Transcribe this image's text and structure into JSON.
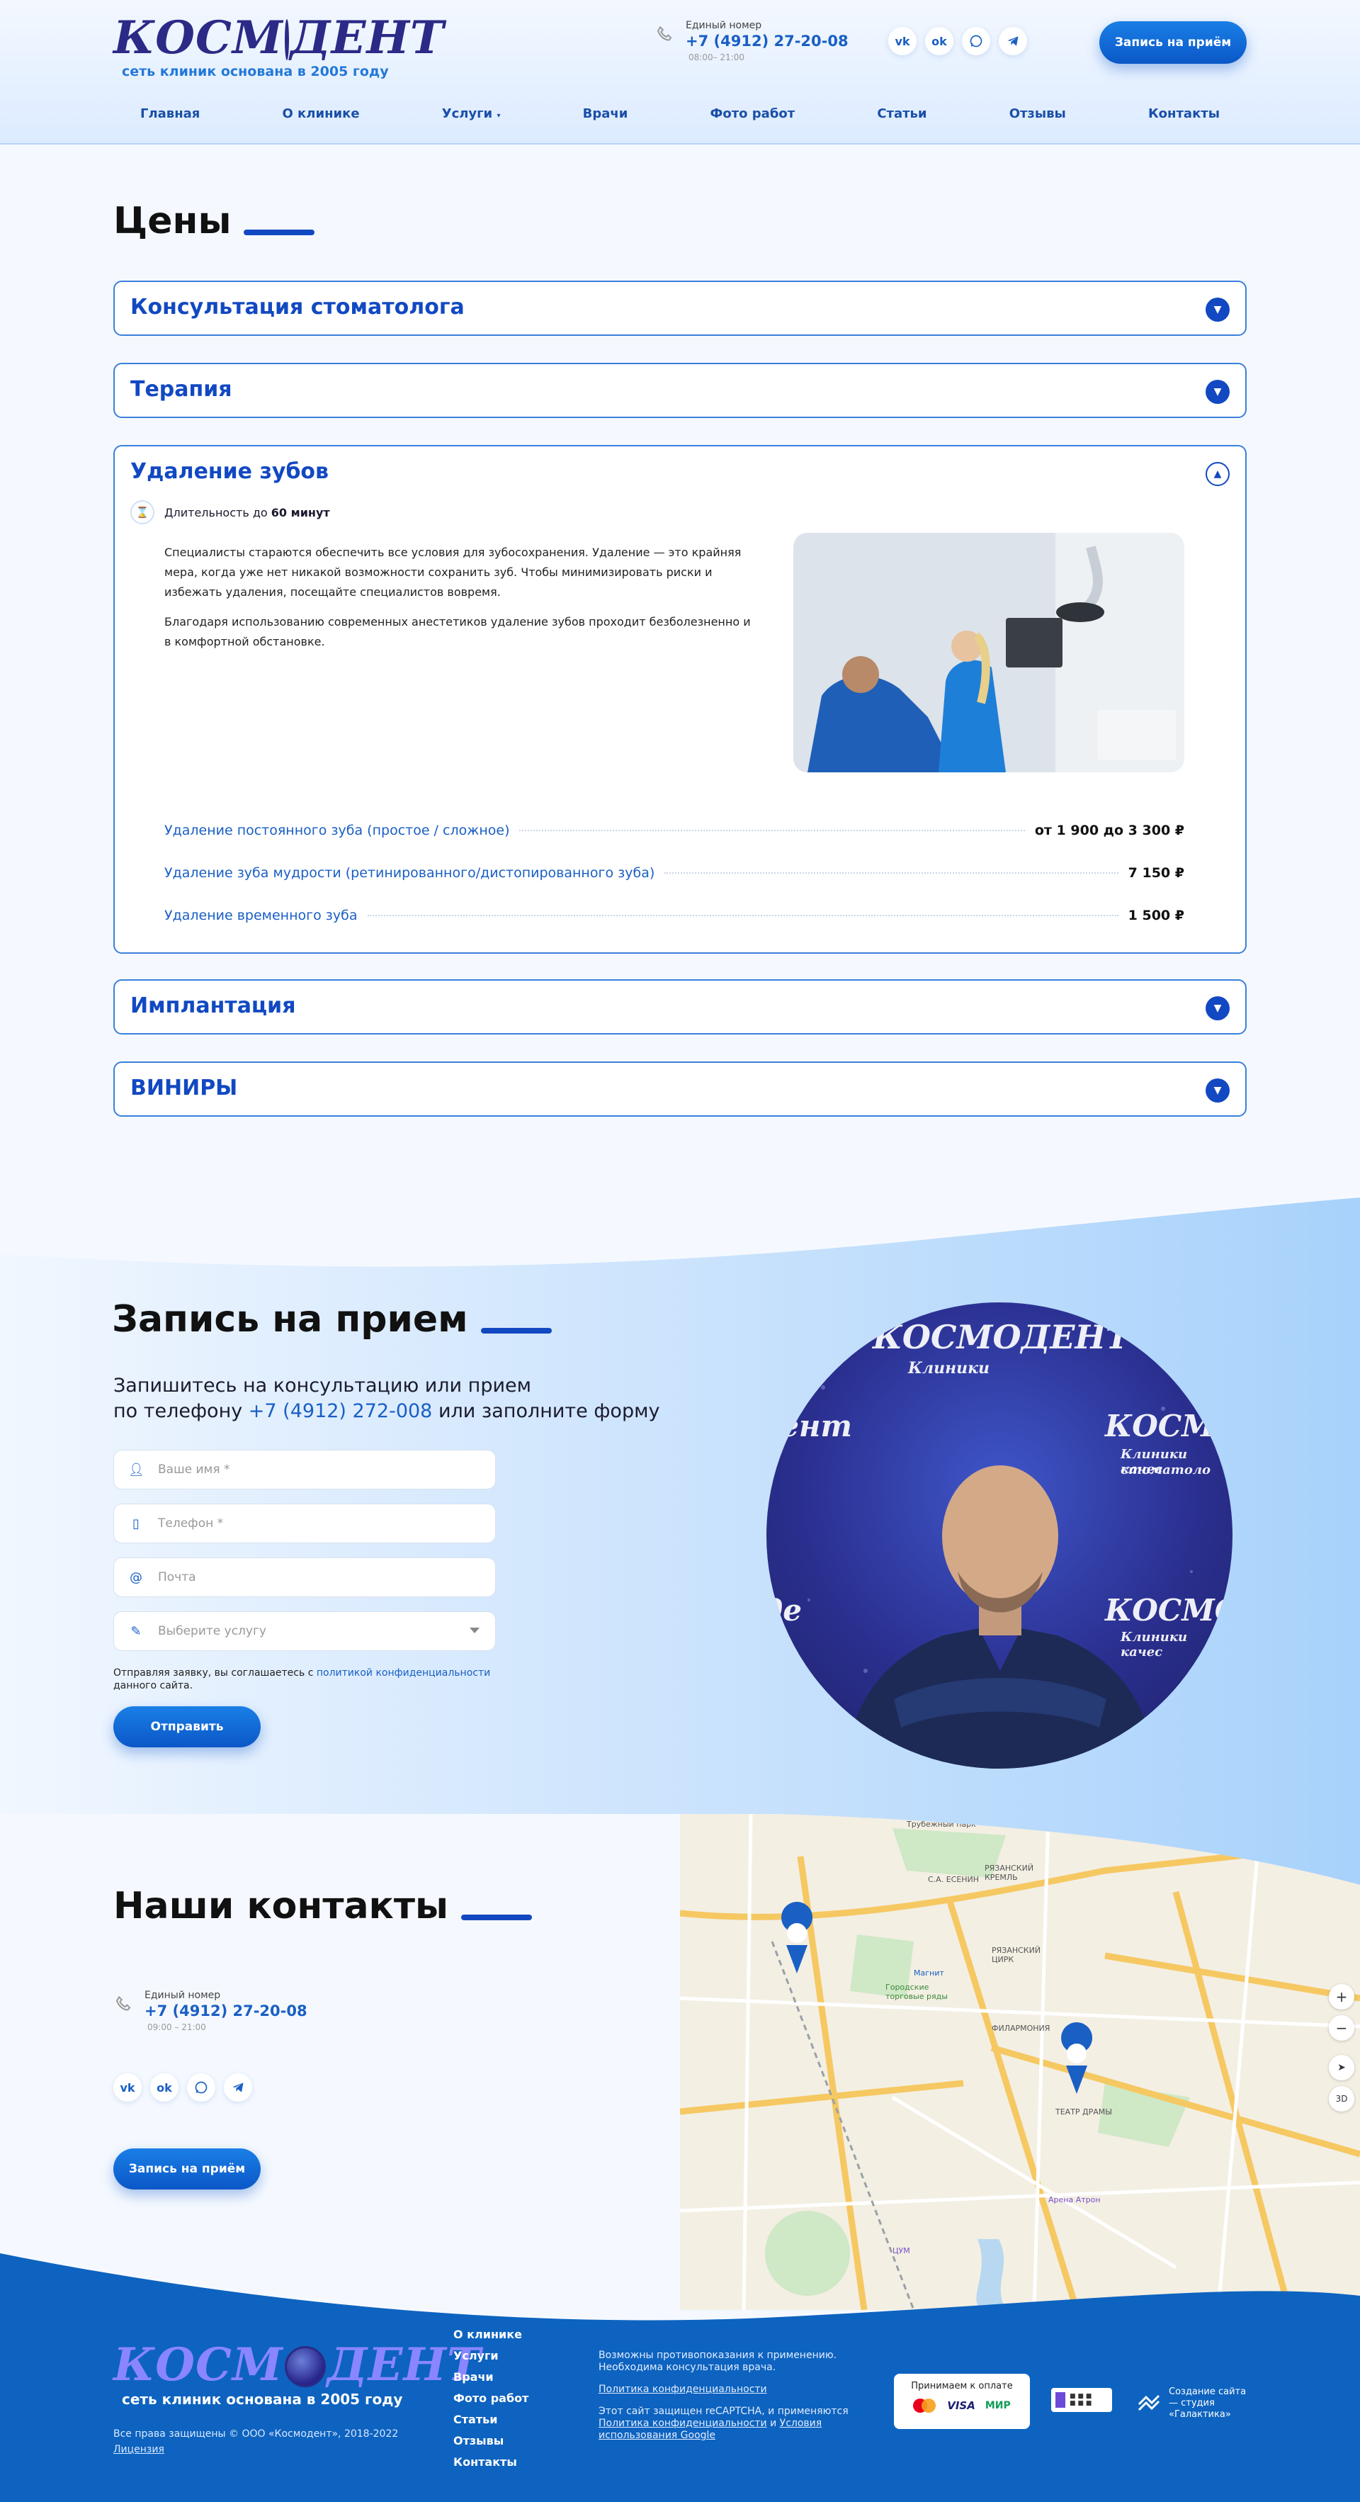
{
  "header": {
    "logo_text_left": "КОСМ",
    "logo_text_right": "ДЕНТ",
    "logo_tagline": "сеть клиник основана в 2005 году",
    "phone_caption": "Единый номер",
    "phone": "+7 (4912) 27-20-08",
    "hours": "08:00– 21:00",
    "cta": "Запись на приём",
    "socials": [
      {
        "icon": "vk-icon",
        "glyph": "vk"
      },
      {
        "icon": "odnoklassniki-icon",
        "glyph": "ok"
      },
      {
        "icon": "whatsapp-icon",
        "glyph": "wa"
      },
      {
        "icon": "telegram-icon",
        "glyph": "tg"
      }
    ]
  },
  "nav": [
    "Главная",
    "О клинике",
    "Услуги",
    "Врачи",
    "Фото работ",
    "Статьи",
    "Отзывы",
    "Контакты"
  ],
  "prices": {
    "title": "Цены",
    "sections": [
      {
        "label": "Консультация стоматолога",
        "open": false
      },
      {
        "label": "Терапия",
        "open": false
      },
      {
        "label": "Удаление зубов",
        "open": true
      },
      {
        "label": "Имплантация",
        "open": false
      },
      {
        "label": "ВИНИРЫ",
        "open": false
      }
    ],
    "open_section": {
      "duration_prefix": "Длительность до",
      "duration_value": "60 минут",
      "paragraph_1": "Специалисты стараются обеспечить все условия для зубосохранения. Удаление — это крайняя мера, когда уже нет никакой возможности сохранить зуб. Чтобы минимизировать риски и избежать удаления, посещайте специалистов вовремя.",
      "paragraph_2": "Благодаря использованию современных анестетиков удаление зубов проходит безболезненно и в комфортной обстановке.",
      "items": [
        {
          "name": "Удаление постоянного зуба (простое / сложное)",
          "price": "от 1 900 до 3 300 ₽"
        },
        {
          "name": "Удаление зуба мудрости (ретинированного/дистопированного зуба)",
          "price": "7 150 ₽"
        },
        {
          "name": "Удаление временного зуба",
          "price": "1 500 ₽"
        }
      ]
    }
  },
  "booking": {
    "title": "Запись на прием",
    "subtitle_line1": "Запишитесь на консультацию или прием",
    "subtitle_line2_before": "по телефону",
    "subtitle_phone": "+7 (4912) 272-008",
    "subtitle_line2_after": "или заполните форму",
    "fields": [
      {
        "icon": "user-icon",
        "placeholder": "Ваше имя *"
      },
      {
        "icon": "phone-icon",
        "placeholder": "Телефон *"
      },
      {
        "icon": "at-icon",
        "placeholder": "Почта"
      },
      {
        "icon": "pencil-icon",
        "placeholder": "Выберите услугу"
      }
    ],
    "consent_before": "Отправляя заявку, вы соглашаетесь с",
    "consent_link": "политикой конфиденциальности",
    "consent_after": "данного сайта.",
    "submit": "Отправить"
  },
  "contacts": {
    "title": "Наши контакты",
    "phone_caption": "Единый номер",
    "phone": "+7 (4912) 27-20-08",
    "hours": "09:00 – 21:00",
    "cta": "Запись на приём",
    "map_labels": [
      "Трубежный парк",
      "С.А. ЕСЕНИН",
      "РЯЗАНСКИЙ КРЕМЛЬ",
      "РЯЗАНСКИЙ ЦИРК",
      "Городские торговые ряды",
      "ФИЛАРМОНИЯ",
      "ТЕАТР ДРАМЫ",
      "Арена Атрон",
      "Магнит",
      "ЦУМ"
    ]
  },
  "footer": {
    "tagline": "сеть клиник основана в 2005 году",
    "copyright": "Все права защищены © ООО «Космодент», 2018-2022",
    "license": "Лицензия",
    "menu": [
      "О клинике",
      "Услуги",
      "Врачи",
      "Фото работ",
      "Статьи",
      "Отзывы",
      "Контакты"
    ],
    "contraindications": "Возможны противопоказания к применению. Необходима консультация врача.",
    "privacy": "Политика конфиденциальности",
    "recaptcha_1": "Этот сайт защищен reCAPTCHA, и применяются",
    "recaptcha_link1": "Политика конфиденциальности",
    "recaptcha_and": "и",
    "recaptcha_link2": "Условия использования Google",
    "pay_caption": "Принимаем к оплате",
    "pay_logos": [
      "VISA",
      "МИР"
    ],
    "studio": "Создание сайта — студия «Галактика»"
  },
  "colors": {
    "accent": "#1249c2",
    "link": "#1a5fc4",
    "footer": "#0d63bf"
  }
}
